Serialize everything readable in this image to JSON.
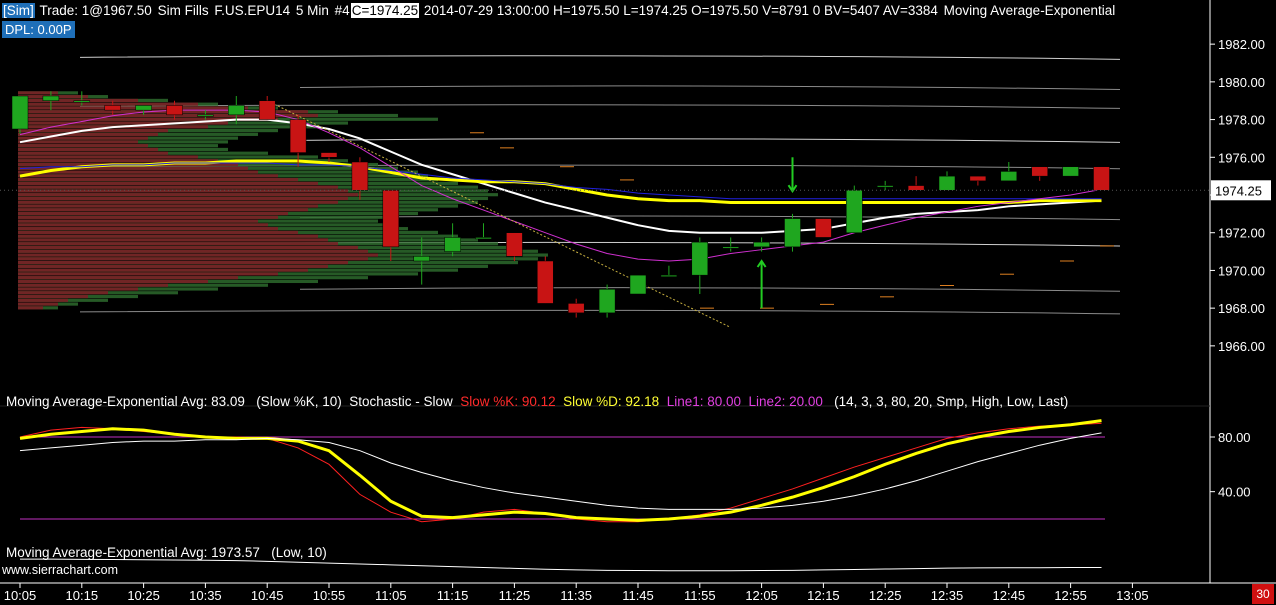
{
  "header": {
    "tag": "[Sim]",
    "trade": "Trade: 1@1967.50",
    "fills": "Sim Fills",
    "symbol": "F.US.EPU14",
    "interval": "5 Min",
    "chart_no": "#4",
    "close": "C=1974.25",
    "stats": "2014-07-29 13:00:00 H=1975.50 L=1974.25 O=1975.50 V=8791 0 BV=5407 AV=3384",
    "study": "Moving Average-Exponential",
    "dpl": "DPL: 0.00P"
  },
  "stoch_header": {
    "ema": "Moving Average-Exponential  Avg: 83.09",
    "ema_params": "(Slow %K, 10)",
    "name": "Stochastic - Slow",
    "k": "Slow %K: 90.12",
    "d": "Slow %D: 92.18",
    "l1": "Line1: 80.00",
    "l2": "Line2: 20.00",
    "params": "(14, 3, 3, 80, 20, Smp, High, Low, Last)"
  },
  "low_header": {
    "ema": "Moving Average-Exponential  Avg: 1973.57",
    "params": "(Low, 10)"
  },
  "watermark": "www.sierrachart.com",
  "scroll_badge": "30",
  "colors": {
    "up": "#1fa61f",
    "down": "#c81414",
    "accent": "#1f6fb8",
    "yellow": "#ffff00",
    "magenta": "#d030d0"
  },
  "chart_data": [
    {
      "type": "candlestick",
      "time_labels": [
        "10:05",
        "10:15",
        "10:25",
        "10:35",
        "10:45",
        "10:55",
        "11:05",
        "11:15",
        "11:25",
        "11:35",
        "11:45",
        "11:55",
        "12:05",
        "12:15",
        "12:25",
        "12:35",
        "12:45",
        "12:55",
        "13:05"
      ],
      "y_ticks": [
        "1982.00",
        "1980.00",
        "1978.00",
        "1976.00",
        "1974.00",
        "1972.00",
        "1970.00",
        "1968.00",
        "1966.00"
      ],
      "ylim": [
        1965.25,
        1982.75
      ],
      "current_price": "1974.25",
      "candles": [
        {
          "t": "10:05",
          "o": 1977.5,
          "h": 1979.0,
          "l": 1977.25,
          "c": 1979.25
        },
        {
          "t": "10:10",
          "o": 1979.0,
          "h": 1979.5,
          "l": 1978.5,
          "c": 1979.25
        },
        {
          "t": "10:15",
          "o": 1979.0,
          "h": 1979.5,
          "l": 1978.75,
          "c": 1979.0
        },
        {
          "t": "10:20",
          "o": 1978.75,
          "h": 1979.0,
          "l": 1978.25,
          "c": 1978.5
        },
        {
          "t": "10:25",
          "o": 1978.5,
          "h": 1978.75,
          "l": 1978.25,
          "c": 1978.75
        },
        {
          "t": "10:30",
          "o": 1978.75,
          "h": 1979.0,
          "l": 1978.0,
          "c": 1978.25
        },
        {
          "t": "10:35",
          "o": 1978.25,
          "h": 1978.5,
          "l": 1978.0,
          "c": 1978.25
        },
        {
          "t": "10:40",
          "o": 1978.25,
          "h": 1979.25,
          "l": 1977.75,
          "c": 1978.75
        },
        {
          "t": "10:45",
          "o": 1979.0,
          "h": 1979.25,
          "l": 1978.0,
          "c": 1978.0
        },
        {
          "t": "10:50",
          "o": 1978.0,
          "h": 1978.25,
          "l": 1975.5,
          "c": 1976.25
        },
        {
          "t": "10:55",
          "o": 1976.25,
          "h": 1976.25,
          "l": 1975.75,
          "c": 1976.0
        },
        {
          "t": "11:00",
          "o": 1975.75,
          "h": 1976.0,
          "l": 1973.75,
          "c": 1974.25
        },
        {
          "t": "11:05",
          "o": 1974.25,
          "h": 1974.25,
          "l": 1970.5,
          "c": 1971.25
        },
        {
          "t": "11:10",
          "o": 1970.5,
          "h": 1971.75,
          "l": 1969.25,
          "c": 1970.75
        },
        {
          "t": "11:15",
          "o": 1971.0,
          "h": 1972.5,
          "l": 1970.75,
          "c": 1971.75
        },
        {
          "t": "11:20",
          "o": 1971.75,
          "h": 1972.5,
          "l": 1971.75,
          "c": 1971.75
        },
        {
          "t": "11:25",
          "o": 1972.0,
          "h": 1972.0,
          "l": 1970.5,
          "c": 1970.75
        },
        {
          "t": "11:30",
          "o": 1970.5,
          "h": 1970.75,
          "l": 1968.25,
          "c": 1968.25
        },
        {
          "t": "11:35",
          "o": 1968.25,
          "h": 1968.5,
          "l": 1967.5,
          "c": 1967.75
        },
        {
          "t": "11:40",
          "o": 1967.75,
          "h": 1969.25,
          "l": 1967.5,
          "c": 1969.0
        },
        {
          "t": "11:45",
          "o": 1968.75,
          "h": 1969.75,
          "l": 1968.75,
          "c": 1969.75
        },
        {
          "t": "11:50",
          "o": 1969.75,
          "h": 1970.25,
          "l": 1969.75,
          "c": 1969.75
        },
        {
          "t": "11:55",
          "o": 1969.75,
          "h": 1971.75,
          "l": 1968.75,
          "c": 1971.5
        },
        {
          "t": "12:00",
          "o": 1971.25,
          "h": 1971.75,
          "l": 1971.0,
          "c": 1971.25
        },
        {
          "t": "12:05",
          "o": 1971.25,
          "h": 1971.75,
          "l": 1971.0,
          "c": 1971.5
        },
        {
          "t": "12:10",
          "o": 1971.25,
          "h": 1973.0,
          "l": 1971.0,
          "c": 1972.75
        },
        {
          "t": "12:15",
          "o": 1972.75,
          "h": 1972.75,
          "l": 1971.75,
          "c": 1971.75
        },
        {
          "t": "12:20",
          "o": 1972.0,
          "h": 1974.5,
          "l": 1972.0,
          "c": 1974.25
        },
        {
          "t": "12:25",
          "o": 1974.5,
          "h": 1974.75,
          "l": 1974.25,
          "c": 1974.5
        },
        {
          "t": "12:30",
          "o": 1974.5,
          "h": 1975.0,
          "l": 1974.25,
          "c": 1974.25
        },
        {
          "t": "12:35",
          "o": 1974.25,
          "h": 1975.25,
          "l": 1974.25,
          "c": 1975.0
        },
        {
          "t": "12:40",
          "o": 1975.0,
          "h": 1975.0,
          "l": 1974.5,
          "c": 1974.75
        },
        {
          "t": "12:45",
          "o": 1974.75,
          "h": 1975.75,
          "l": 1974.75,
          "c": 1975.25
        },
        {
          "t": "12:50",
          "o": 1975.5,
          "h": 1975.5,
          "l": 1974.75,
          "c": 1975.0
        },
        {
          "t": "12:55",
          "o": 1975.0,
          "h": 1975.5,
          "l": 1975.0,
          "c": 1975.5
        },
        {
          "t": "13:00",
          "o": 1975.5,
          "h": 1975.5,
          "l": 1974.25,
          "c": 1974.25
        }
      ],
      "series": [
        {
          "color": "#ffffff",
          "values": [
            1976.8,
            1977.1,
            1977.4,
            1977.6,
            1977.7,
            1977.8,
            1977.9,
            1978.0,
            1978.0,
            1977.8,
            1977.5,
            1977.0,
            1976.3,
            1975.6,
            1975.1,
            1974.6,
            1974.1,
            1973.6,
            1973.2,
            1972.8,
            1972.4,
            1972.1,
            1972.0,
            1972.0,
            1972.0,
            1972.1,
            1972.2,
            1972.5,
            1972.8,
            1973.0,
            1973.1,
            1973.2,
            1973.4,
            1973.5,
            1973.6,
            1973.7
          ],
          "width": 2
        },
        {
          "color": "#ffff00",
          "values": [
            1975.0,
            1975.3,
            1975.5,
            1975.6,
            1975.6,
            1975.7,
            1975.7,
            1975.8,
            1975.8,
            1975.8,
            1975.7,
            1975.5,
            1975.2,
            1974.9,
            1974.8,
            1974.7,
            1974.7,
            1974.6,
            1974.3,
            1974.0,
            1973.8,
            1973.7,
            1973.7,
            1973.6,
            1973.6,
            1973.6,
            1973.6,
            1973.6,
            1973.6,
            1973.6,
            1973.6,
            1973.6,
            1973.6,
            1973.7,
            1973.7,
            1973.7
          ],
          "width": 3
        },
        {
          "color": "#2020dd",
          "values": [
            1975.4,
            1975.5,
            1975.5,
            1975.6,
            1975.6,
            1975.7,
            1975.7,
            1975.7,
            1975.7,
            1975.6,
            1975.6,
            1975.5,
            1975.3,
            1975.1,
            1974.9,
            1974.8,
            1974.7,
            1974.6,
            1974.4,
            1974.3,
            1974.1,
            1974.0,
            1973.9,
            1973.8,
            1973.8,
            1973.8,
            1973.8,
            1973.8,
            1973.8,
            1973.8,
            1973.8,
            1973.8,
            1973.8,
            1973.8,
            1973.8,
            1973.8
          ],
          "width": 1
        },
        {
          "color": "#d030d0",
          "values": [
            1977.2,
            1977.6,
            1977.9,
            1978.2,
            1978.4,
            1978.5,
            1978.5,
            1978.5,
            1978.4,
            1978.0,
            1977.3,
            1976.5,
            1975.5,
            1974.5,
            1973.8,
            1973.2,
            1972.6,
            1972.0,
            1971.4,
            1970.9,
            1970.6,
            1970.5,
            1970.6,
            1970.9,
            1971.1,
            1971.3,
            1971.5,
            1972.0,
            1972.4,
            1972.8,
            1973.1,
            1973.4,
            1973.6,
            1973.8,
            1974.0,
            1974.3
          ],
          "width": 1
        }
      ],
      "trend_line": {
        "color": "#c8b040",
        "from": {
          "t": "10:45",
          "v": 1979.0
        },
        "to": {
          "t": "11:55",
          "v": 1967.0
        }
      },
      "signals": [
        {
          "t": "12:10",
          "from": 1976.0,
          "to": 1974.2,
          "dir": "down",
          "color": "#22cc22"
        },
        {
          "t": "12:05",
          "from": 1968.0,
          "to": 1970.5,
          "dir": "up",
          "color": "#22cc22"
        }
      ]
    },
    {
      "type": "line",
      "y_ticks": [
        "80.00",
        "40.00"
      ],
      "ylim": [
        0,
        100
      ],
      "reference_lines": [
        80,
        20
      ],
      "series": [
        {
          "color": "#ff2020",
          "values": [
            80,
            85,
            87,
            86,
            84,
            82,
            80,
            80,
            79,
            72,
            60,
            38,
            25,
            18,
            20,
            25,
            27,
            24,
            20,
            18,
            18,
            20,
            23,
            28,
            35,
            42,
            50,
            58,
            65,
            72,
            79,
            83,
            86,
            88,
            89,
            90
          ],
          "width": 1
        },
        {
          "color": "#ffff00",
          "values": [
            79,
            82,
            84,
            86,
            85,
            82,
            80,
            79,
            79,
            77,
            70,
            52,
            33,
            22,
            21,
            23,
            25,
            24,
            21,
            20,
            19,
            20,
            22,
            25,
            30,
            36,
            43,
            51,
            60,
            68,
            75,
            80,
            84,
            87,
            89,
            92
          ],
          "width": 3
        },
        {
          "color": "#ffffff",
          "values": [
            70,
            72,
            74,
            76,
            77,
            77,
            78,
            78,
            79,
            78,
            76,
            70,
            61,
            54,
            48,
            43,
            39,
            36,
            33,
            30,
            28,
            27,
            27,
            27,
            28,
            30,
            33,
            37,
            42,
            48,
            55,
            62,
            68,
            74,
            79,
            83
          ],
          "width": 1
        }
      ]
    },
    {
      "type": "line",
      "series": [
        {
          "color": "#ffffff",
          "values": [
            1977.4,
            1977.4,
            1977.3,
            1977.2,
            1977.1,
            1977.0,
            1976.9,
            1976.7,
            1976.4,
            1976.0,
            1975.6,
            1975.2,
            1974.8,
            1974.4,
            1974.0,
            1973.6,
            1973.2,
            1972.8,
            1972.5,
            1972.3,
            1972.2,
            1972.1,
            1972.1,
            1972.1,
            1972.2,
            1972.3,
            1972.5,
            1972.7,
            1972.9,
            1973.1,
            1973.3,
            1973.4,
            1973.5,
            1973.5,
            1973.6,
            1973.6
          ],
          "width": 1
        }
      ]
    }
  ]
}
